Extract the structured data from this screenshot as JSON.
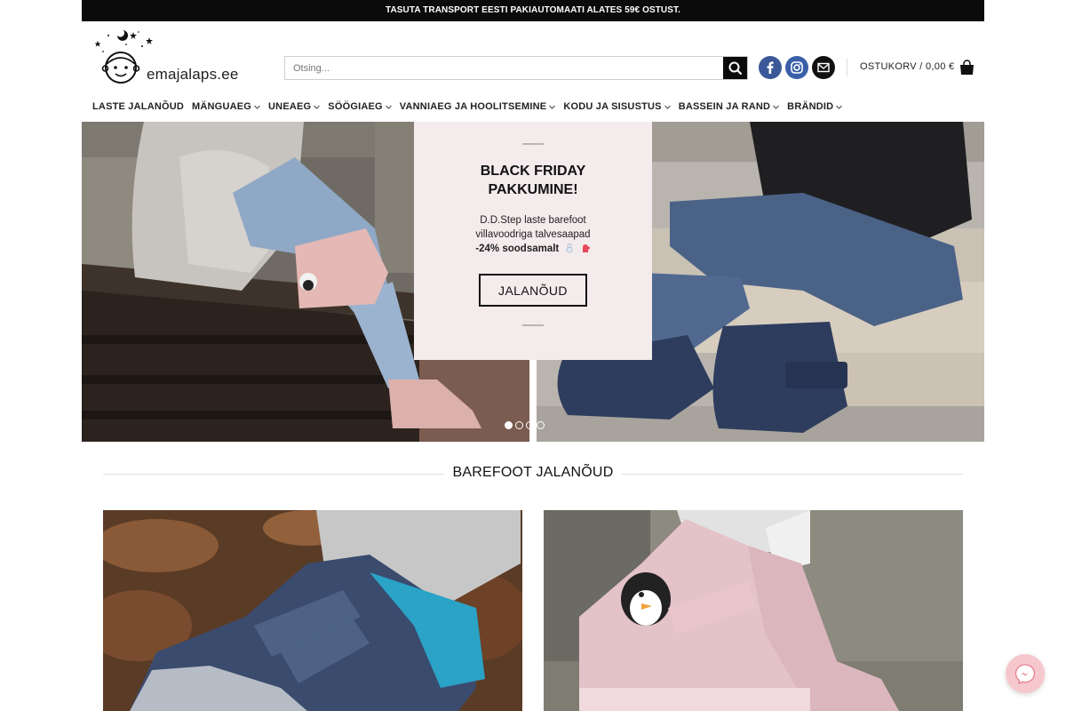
{
  "topbar": {
    "text": "TASUTA TRANSPORT EESTI PAKIAUTOMAATI ALATES 59€ OSTUST."
  },
  "header": {
    "logo_text": "emajalaps.ee",
    "search": {
      "placeholder": "Otsing..."
    },
    "cart_label": "OSTUKORV / 0,00 €",
    "icons": [
      "search-icon",
      "facebook-icon",
      "instagram-icon",
      "mail-icon",
      "shopping-bag-icon"
    ]
  },
  "nav": {
    "items": [
      {
        "label": "LASTE JALANÕUD",
        "dropdown": false
      },
      {
        "label": "MÄNGUAEG",
        "dropdown": true
      },
      {
        "label": "UNEAEG",
        "dropdown": true
      },
      {
        "label": "SÖÖGIAEG",
        "dropdown": true
      },
      {
        "label": "VANNIAEG JA HOOLITSEMINE",
        "dropdown": true
      },
      {
        "label": "KODU JA SISUSTUS",
        "dropdown": true
      },
      {
        "label": "BASSEIN JA RAND",
        "dropdown": true
      },
      {
        "label": "BRÄNDID",
        "dropdown": true
      }
    ]
  },
  "hero": {
    "title_line1": "BLACK FRIDAY",
    "title_line2": "PAKKUMINE!",
    "text_line1": "D.D.Step laste barefoot",
    "text_line2": "villavoodriga talvesaapad",
    "text_line3": "-24% soodsamalt",
    "button_label": "JALANÕUD",
    "slides_count": 4,
    "active_slide": 1
  },
  "section": {
    "title": "BAREFOOT JALANÕUD"
  },
  "colors": {
    "topbar": "#0b0b0b",
    "hero_box": "#f4ebec",
    "facebook": "#3b5998",
    "instagram": "#3a5fa8",
    "messenger_bg": "#f6c7cc"
  }
}
